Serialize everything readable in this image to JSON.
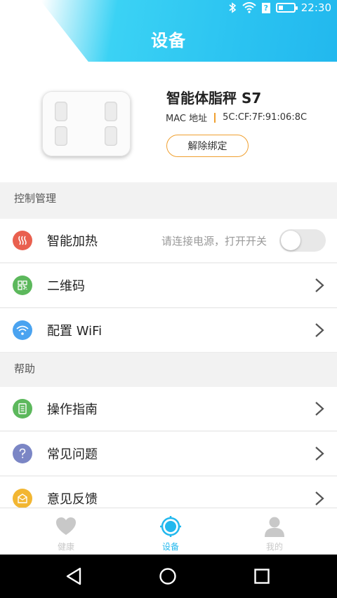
{
  "status_bar": {
    "time": "22:30"
  },
  "header": {
    "title": "设备"
  },
  "device": {
    "name": "智能体脂秤 S7",
    "mac_label": "MAC 地址",
    "mac_value": "5C:CF:7F:91:06:8C",
    "unbind_label": "解除绑定"
  },
  "sections": {
    "control": "控制管理",
    "help": "帮助"
  },
  "control_items": [
    {
      "label": "智能加热",
      "hint": "请连接电源，打开开关",
      "icon": "heat-icon",
      "color": "#e9604f"
    },
    {
      "label": "二维码",
      "icon": "qr-code-icon",
      "color": "#5cb85c"
    },
    {
      "label": "配置 WiFi",
      "icon": "wifi-icon",
      "color": "#4aa3f0"
    }
  ],
  "help_items": [
    {
      "label": "操作指南",
      "icon": "guide-icon",
      "color": "#5cb85c"
    },
    {
      "label": "常见问题",
      "icon": "question-icon",
      "color": "#7b86c5"
    },
    {
      "label": "意见反馈",
      "icon": "feedback-icon",
      "color": "#f2b632"
    }
  ],
  "tabs": [
    {
      "label": "健康",
      "icon": "heart-icon"
    },
    {
      "label": "设备",
      "icon": "device-target-icon",
      "active": true
    },
    {
      "label": "我的",
      "icon": "person-icon"
    }
  ],
  "colors": {
    "accent": "#22b8ee",
    "unbind_border": "#f0a030"
  },
  "toggle": {
    "heating_on": false
  }
}
